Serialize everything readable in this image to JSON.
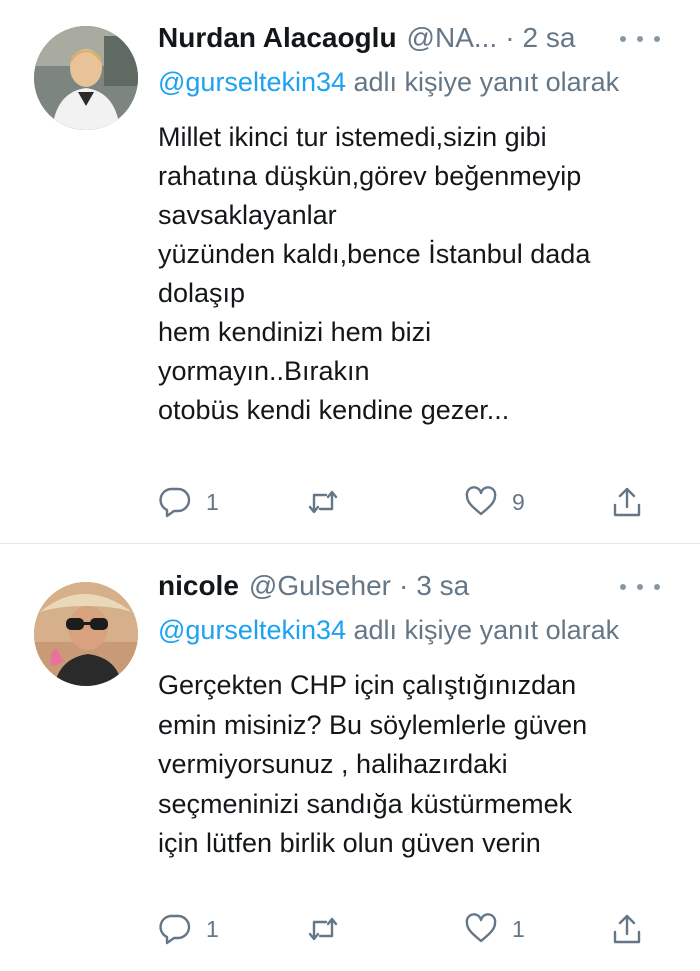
{
  "tweets": [
    {
      "name": "Nurdan Alacaoglu",
      "handle": "@NA...",
      "separator": "·",
      "time": "2 sa",
      "replying_mention": "@gurseltekin34",
      "replying_suffix": " adlı kişiye yanıt olarak",
      "text": "Millet ikinci tur istemedi,sizin gibi\nrahatına düşkün,görev beğenmeyip\nsavsaklayanlar\nyüzünden kaldı,bence İstanbul dada\ndolaşıp\nhem kendinizi hem bizi\nyormayın..Bırakın\notobüs kendi kendine gezer...",
      "reply_count": "1",
      "retweet_count": "",
      "like_count": "9"
    },
    {
      "name": "nicole",
      "handle": "@Gulseher",
      "separator": "·",
      "time": "3 sa",
      "replying_mention": "@gurseltekin34",
      "replying_suffix": " adlı kişiye yanıt olarak",
      "text": "Gerçekten CHP için çalıştığınızdan\nemin misiniz? Bu söylemlerle güven\nvermiyorsunuz , halihazırdaki\nseçmeninizi sandığa küstürmemek\niçin lütfen birlik olun güven verin",
      "reply_count": "1",
      "retweet_count": "",
      "like_count": "1"
    }
  ],
  "icons": {
    "reply": "reply-icon",
    "retweet": "retweet-icon",
    "like": "heart-icon",
    "share": "share-icon",
    "more": "more-icon"
  },
  "colors": {
    "link": "#1da1f2",
    "secondary": "#657786",
    "text": "#14171a",
    "divider": "#e1e8ed"
  }
}
